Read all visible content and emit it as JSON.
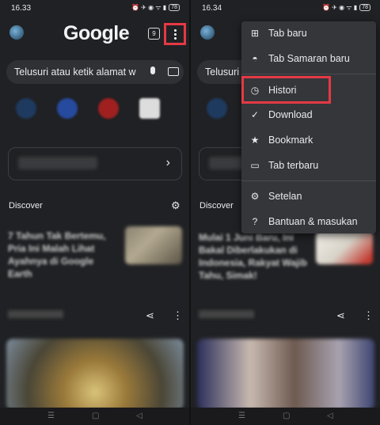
{
  "left": {
    "status_time": "16.33",
    "status_icons": "⏰ ✈ ◉ ᯤ ▮",
    "battery": "78",
    "logo": "Google",
    "tab_count": "9",
    "search_placeholder": "Telusuri atau ketik alamat w",
    "discover_label": "Discover",
    "article_title": "7 Tahun Tak Bertemu, Pria Ini Malah Lihat Ayahnya di Google Earth"
  },
  "right": {
    "status_time": "16.34",
    "status_icons": "⏰ ✈ ◉ ᯤ ▮",
    "battery": "78",
    "search_placeholder": "Telusuri",
    "discover_label": "Discover",
    "article_title": "Mulai 1 Juni Baru, Ini Bakal Diberlakukan di Indonesia, Rakyat Wajib Tahu, Simak!",
    "menu_items": [
      {
        "icon": "new-tab-icon",
        "label": "Tab baru"
      },
      {
        "icon": "incognito-icon",
        "label": "Tab Samaran baru"
      },
      {
        "icon": "history-icon",
        "label": "Histori"
      },
      {
        "icon": "download-icon",
        "label": "Download"
      },
      {
        "icon": "bookmark-icon",
        "label": "Bookmark"
      },
      {
        "icon": "recent-tabs-icon",
        "label": "Tab terbaru"
      },
      {
        "icon": "settings-icon",
        "label": "Setelan"
      },
      {
        "icon": "help-icon",
        "label": "Bantuan & masukan"
      }
    ]
  },
  "highlight_color": "#e53945"
}
